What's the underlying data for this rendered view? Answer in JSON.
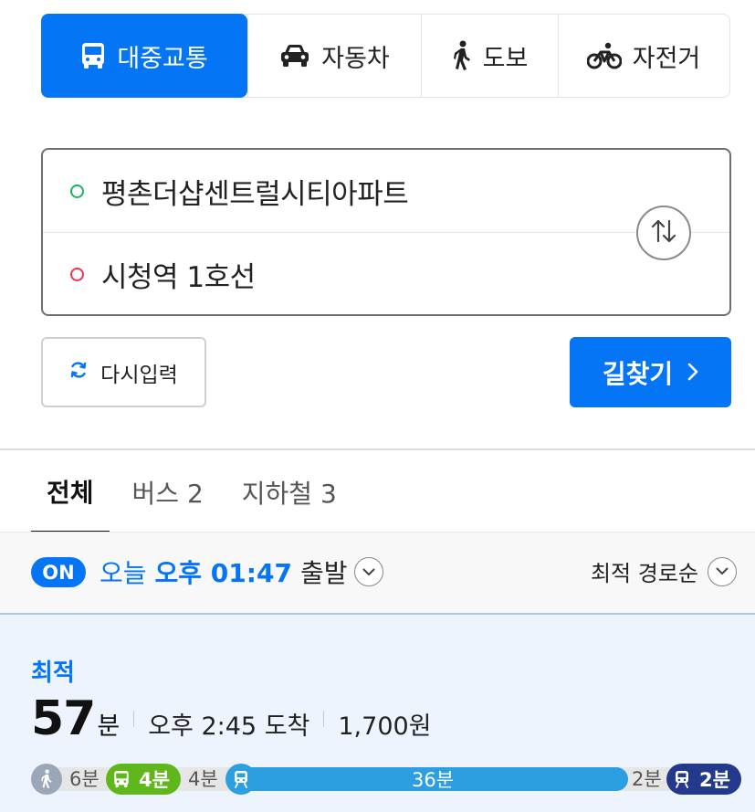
{
  "mode_tabs": [
    {
      "label": "대중교통",
      "icon": "bus-icon",
      "active": true
    },
    {
      "label": "자동차",
      "icon": "car-icon",
      "active": false
    },
    {
      "label": "도보",
      "icon": "walk-icon",
      "active": false
    },
    {
      "label": "자전거",
      "icon": "bicycle-icon",
      "active": false
    }
  ],
  "route": {
    "origin": "평촌더샵센트럴시티아파트",
    "destination": "시청역 1호선"
  },
  "actions": {
    "reset_label": "다시입력",
    "search_label": "길찾기"
  },
  "filter_tabs": [
    {
      "label": "전체",
      "active": true
    },
    {
      "label": "버스 2",
      "active": false
    },
    {
      "label": "지하철 3",
      "active": false
    }
  ],
  "departure": {
    "badge": "ON",
    "day": "오늘",
    "time": "오후 01:47",
    "suffix": "출발",
    "sort_label": "최적 경로순"
  },
  "result": {
    "label": "최적",
    "minutes": "57",
    "minutes_unit": "분",
    "arrival": "오후 2:45 도착",
    "fare": "1,700원",
    "segments": {
      "walk_label": "6분",
      "bus_label": "4분",
      "transfer_label": "4분",
      "subway_label": "36분",
      "transfer2_label": "2분",
      "subway2_label": "2분"
    }
  },
  "colors": {
    "accent": "#0475f4",
    "walk": "#9aa7b8",
    "bus": "#5fb71b",
    "subway4": "#2c9fe0",
    "subway1": "#233a8c"
  }
}
